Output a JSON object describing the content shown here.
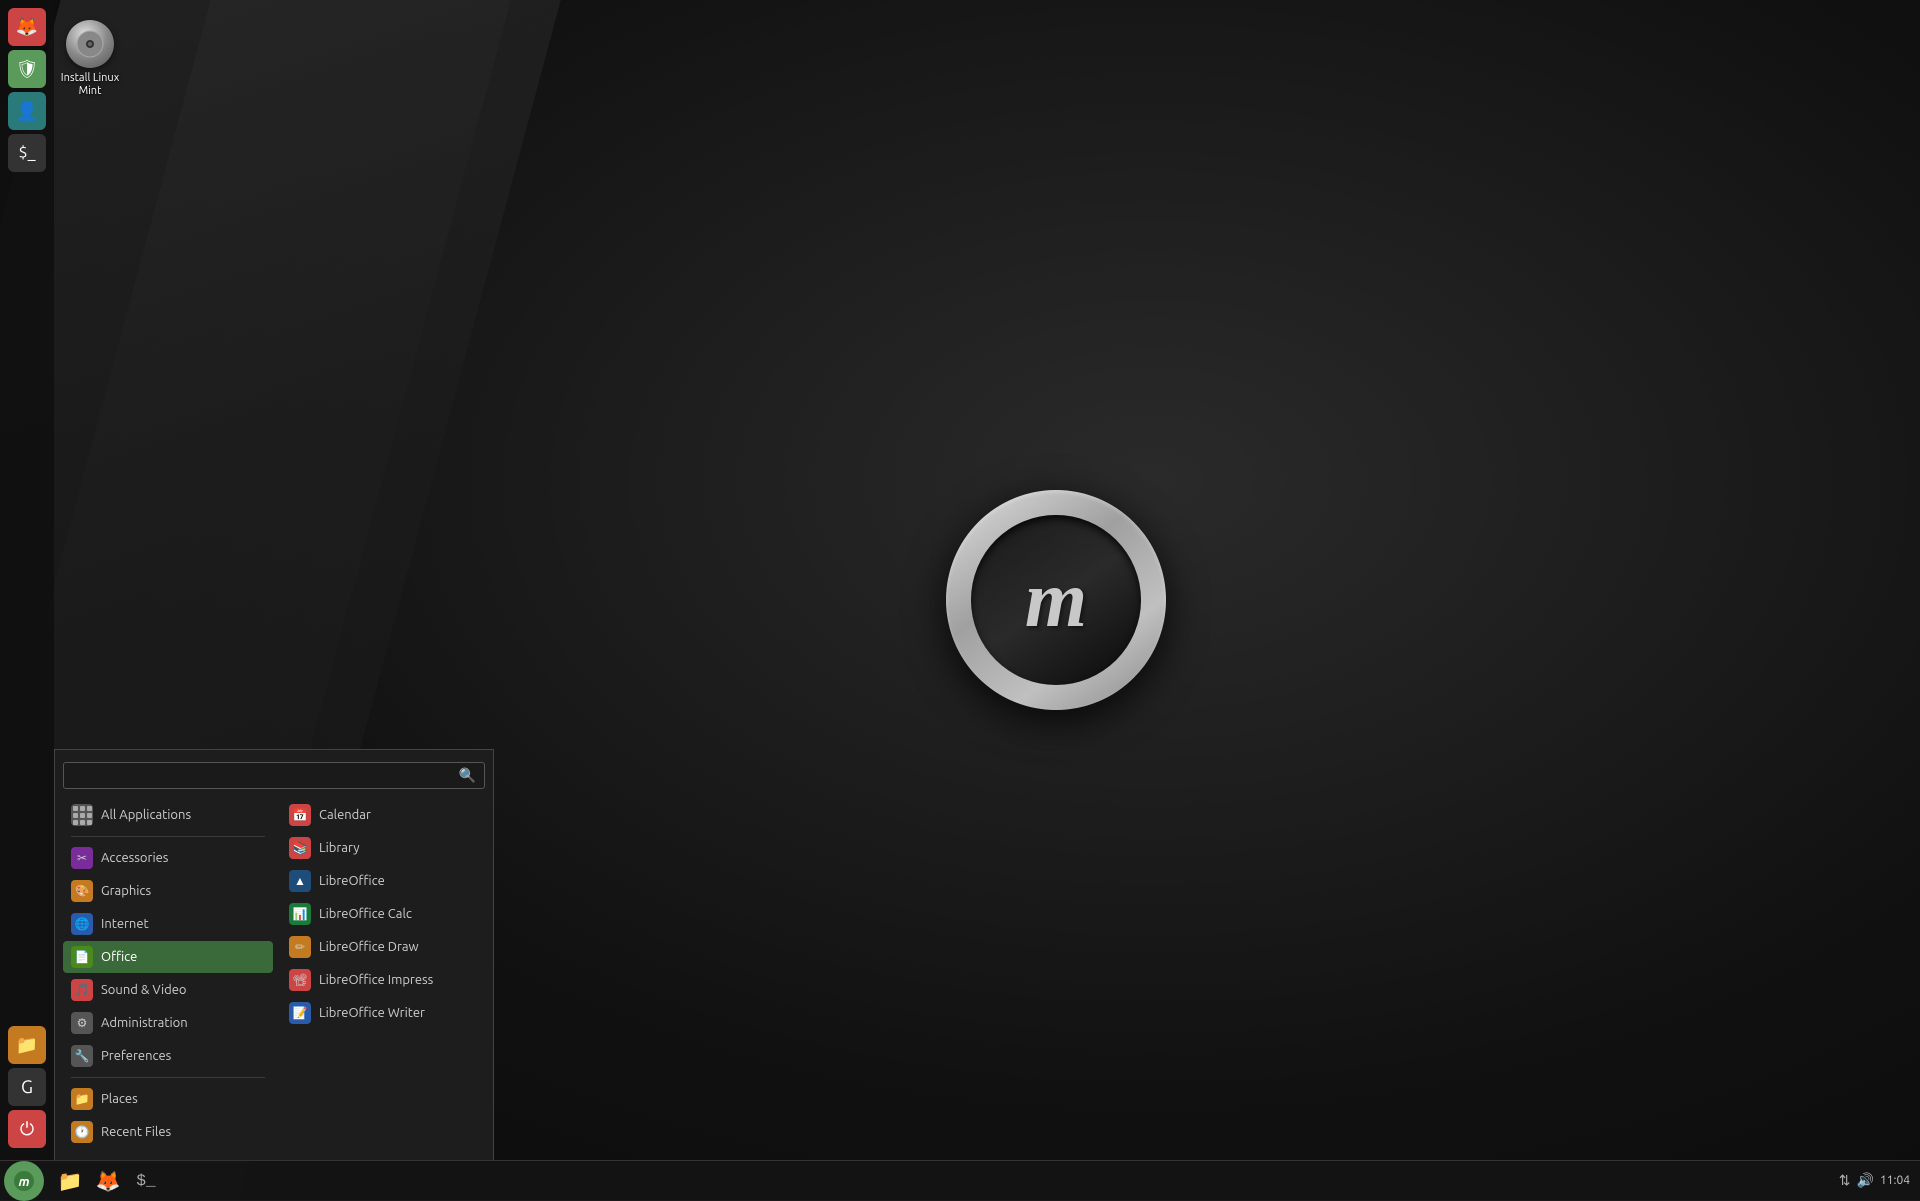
{
  "desktop": {
    "background_color": "#111111",
    "icon": {
      "label": "Install Linux Mint",
      "icon_type": "disc"
    }
  },
  "taskbar": {
    "start_button_label": "Start",
    "items": [
      {
        "name": "files",
        "icon": "folder",
        "color": "#f0a020"
      },
      {
        "name": "firefox",
        "icon": "🦊",
        "color": "#c44"
      },
      {
        "name": "terminal",
        "icon": "terminal",
        "color": "#333"
      }
    ],
    "systray": {
      "network_icon": "⇅",
      "sound_icon": "🔊",
      "time": "11:04"
    }
  },
  "sidebar": {
    "icons": [
      {
        "name": "firefox",
        "color": "#c44"
      },
      {
        "name": "mint-update",
        "color": "#5a9a5a"
      },
      {
        "name": "contacts",
        "color": "#2a7a7a"
      },
      {
        "name": "terminal",
        "color": "#333"
      },
      {
        "name": "folder",
        "color": "#c47a20"
      },
      {
        "name": "google",
        "color": "#444"
      },
      {
        "name": "power",
        "color": "#c44"
      }
    ]
  },
  "start_menu": {
    "search_placeholder": "",
    "left_items": [
      {
        "id": "all-applications",
        "label": "All Applications",
        "icon_type": "grid",
        "icon_color": "#555"
      },
      {
        "id": "accessories",
        "label": "Accessories",
        "icon_type": "✂",
        "icon_color": "#7a5aaa"
      },
      {
        "id": "graphics",
        "label": "Graphics",
        "icon_type": "🎨",
        "icon_color": "#aa5a2a"
      },
      {
        "id": "internet",
        "label": "Internet",
        "icon_type": "🌐",
        "icon_color": "#2a5aaa"
      },
      {
        "id": "office",
        "label": "Office",
        "icon_type": "📄",
        "icon_color": "#2d7a2d",
        "active": true
      },
      {
        "id": "sound-video",
        "label": "Sound & Video",
        "icon_type": "🎵",
        "icon_color": "#c44"
      },
      {
        "id": "administration",
        "label": "Administration",
        "icon_type": "⚙",
        "icon_color": "#888"
      },
      {
        "id": "preferences",
        "label": "Preferences",
        "icon_type": "🔧",
        "icon_color": "#666"
      },
      {
        "id": "places",
        "label": "Places",
        "icon_type": "📁",
        "icon_color": "#c47a20"
      },
      {
        "id": "recent-files",
        "label": "Recent Files",
        "icon_type": "🕐",
        "icon_color": "#c47a20"
      }
    ],
    "right_items": [
      {
        "id": "calendar",
        "label": "Calendar",
        "icon_color": "#c44"
      },
      {
        "id": "library",
        "label": "Library",
        "icon_color": "#c44"
      },
      {
        "id": "libreoffice",
        "label": "LibreOffice",
        "icon_color": "#1e4d7a"
      },
      {
        "id": "libreoffice-calc",
        "label": "LibreOffice Calc",
        "icon_color": "#1a7a3a"
      },
      {
        "id": "libreoffice-draw",
        "label": "LibreOffice Draw",
        "icon_color": "#c47a20"
      },
      {
        "id": "libreoffice-impress",
        "label": "LibreOffice Impress",
        "icon_color": "#c44"
      },
      {
        "id": "libreoffice-writer",
        "label": "LibreOffice Writer",
        "icon_color": "#2a5aaa"
      }
    ]
  }
}
